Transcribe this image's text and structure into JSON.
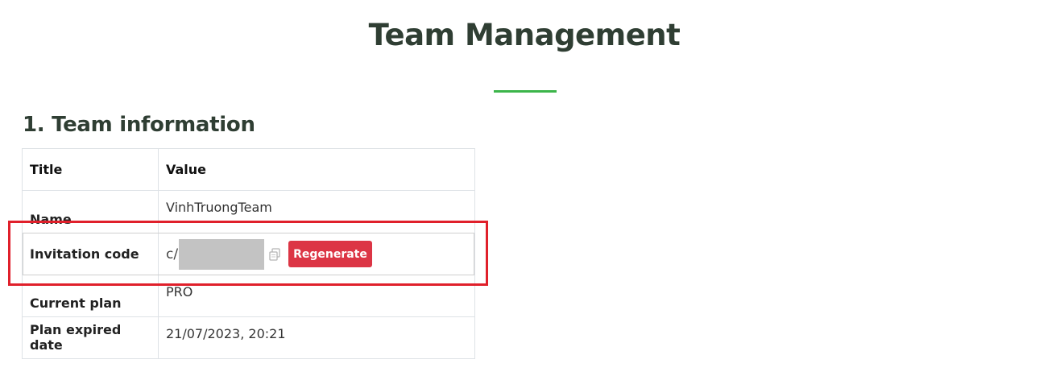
{
  "page": {
    "title": "Team Management",
    "accent_color": "#3cb54a",
    "highlight_color": "#e0202b"
  },
  "team_info": {
    "heading": "1. Team information",
    "columns": {
      "title": "Title",
      "value": "Value"
    },
    "rows": {
      "name": {
        "label": "Name",
        "value": "VinhTruongTeam"
      },
      "invitation": {
        "label": "Invitation code",
        "code_prefix": "c/",
        "copy_icon": "copy-icon",
        "regenerate_label": "Regenerate",
        "regenerate_color": "#dc3545"
      },
      "plan": {
        "label": "Current plan",
        "value": "PRO"
      },
      "expire": {
        "label": "Plan expired date",
        "value": "21/07/2023, 20:21"
      }
    }
  }
}
